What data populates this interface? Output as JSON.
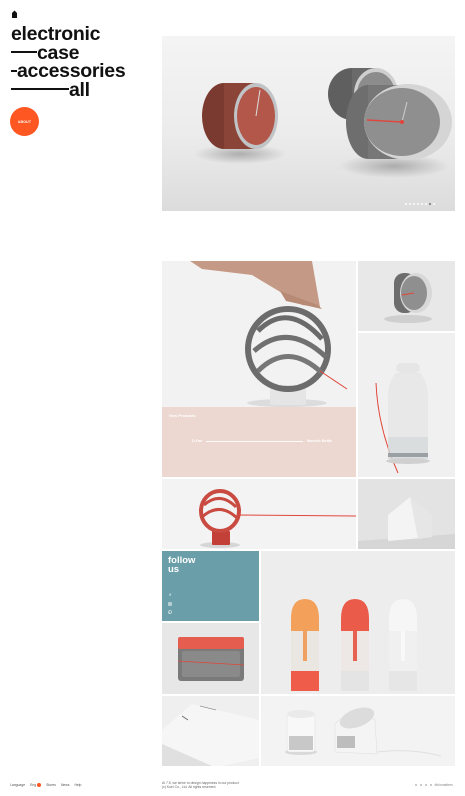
{
  "heading": {
    "line1": "electronic",
    "line2": "case",
    "line3": "accessories",
    "line4": "all"
  },
  "about_button": {
    "label": "ABOUT"
  },
  "hero": {
    "dot_count": 8,
    "active_dot": 6
  },
  "news": {
    "title": "New Products",
    "item_left": "D-Fan",
    "item_right": "Monotic Bottle"
  },
  "follow": {
    "title_line1": "follow",
    "title_line2": "us",
    "icons": [
      "facebook-icon",
      "instagram-icon",
      "pinterest-icon"
    ]
  },
  "footer": {
    "language_label": "Language",
    "language_value": "Eng",
    "links": [
      "Stores",
      "News",
      "Help"
    ],
    "copyright_line1": "Al 7.5, we strive to design happiness in our product",
    "copyright_line2": "(c) Koei Co., Ltd. All rights reserved.",
    "right_label": "#thismatters"
  },
  "colors": {
    "accent": "#ff5722",
    "news_bg": "#ecd8d0",
    "follow_bg": "#6a9ea8"
  }
}
